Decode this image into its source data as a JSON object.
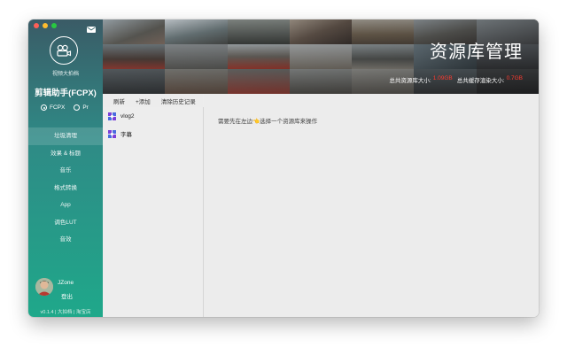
{
  "window": {
    "title": "资源库管理"
  },
  "sidebar": {
    "brand": "视频大拍档",
    "app_title": "剪辑助手(FCPX)",
    "radios": [
      {
        "label": "FCPX",
        "selected": true
      },
      {
        "label": "Pr",
        "selected": false
      }
    ],
    "nav": [
      {
        "label": "垃圾清理",
        "active": true
      },
      {
        "label": "效果 & 标题",
        "active": false
      },
      {
        "label": "音乐",
        "active": false
      },
      {
        "label": "格式转换",
        "active": false
      },
      {
        "label": "App",
        "active": false
      },
      {
        "label": "调色LUT",
        "active": false
      },
      {
        "label": "音效",
        "active": false
      }
    ],
    "user": {
      "name": "JZone",
      "action": "登出"
    },
    "footer": "v0.1.4 | 大拍档 | 淘宝店"
  },
  "header": {
    "title": "资源库管理",
    "stats": {
      "total_label": "总共资源库大小:",
      "total_value": "1.09GB",
      "cache_label": "总共缓存渲染大小:",
      "cache_value": "0.7GB"
    }
  },
  "toolbar": {
    "refresh": "刷新",
    "add": "+添加",
    "clear_history": "清除历史记录"
  },
  "libraries": [
    {
      "name": "vlog2"
    },
    {
      "name": "字幕"
    }
  ],
  "content": {
    "hint": "需要先在左边👈选择一个资源库来操作"
  },
  "colors": {
    "accent_green": "#1fa88a",
    "alert_red": "#ff3b30"
  }
}
